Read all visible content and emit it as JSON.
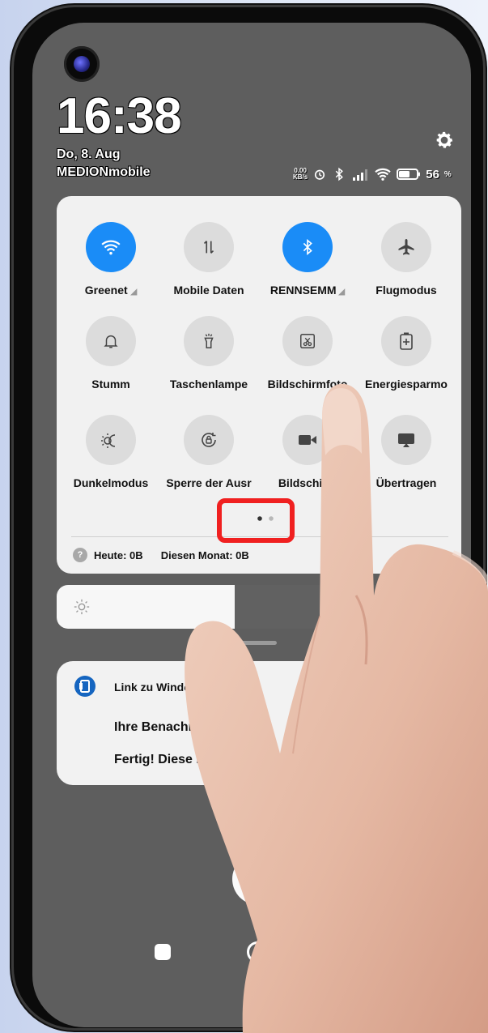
{
  "status_bar": {
    "time": "16:38",
    "date": "Do, 8. Aug",
    "carrier": "MEDIONmobile",
    "speed_value": "0.00",
    "speed_unit": "KB/s",
    "battery": "56"
  },
  "quick_settings": {
    "tiles": [
      {
        "label": "Greenet",
        "icon": "wifi-icon",
        "active": true
      },
      {
        "label": "Mobile Daten",
        "icon": "mobile-data-icon",
        "active": false
      },
      {
        "label": "RENNSEMM",
        "icon": "bluetooth-icon",
        "active": true
      },
      {
        "label": "Flugmodus",
        "icon": "airplane-icon",
        "active": false
      },
      {
        "label": "Stumm",
        "icon": "bell-icon",
        "active": false
      },
      {
        "label": "Taschenlampe",
        "icon": "flashlight-icon",
        "active": false
      },
      {
        "label": "Bildschirmfoto",
        "icon": "screenshot-icon",
        "active": false
      },
      {
        "label": "Energiesparmo",
        "icon": "battery-saver-icon",
        "active": false
      },
      {
        "label": "Dunkelmodus",
        "icon": "dark-mode-icon",
        "active": false
      },
      {
        "label": "Sperre der Ausr",
        "icon": "rotation-lock-icon",
        "active": false
      },
      {
        "label": "Bildschirm",
        "icon": "screen-record-icon",
        "active": false
      },
      {
        "label": "Übertragen",
        "icon": "cast-icon",
        "active": false
      }
    ],
    "page_indicator": {
      "current": 1,
      "total": 2
    },
    "data_usage_today": "Heute: 0B",
    "data_usage_month": "Diesen Monat: 0B"
  },
  "brightness": {
    "level": 0.44
  },
  "notification": {
    "app_name": "Link zu Windo",
    "title": "Ihre Benachri      sind a",
    "body": "Fertig! Diese Be           igung"
  },
  "colors": {
    "accent": "#1a8cf7",
    "highlight": "#f02020"
  }
}
